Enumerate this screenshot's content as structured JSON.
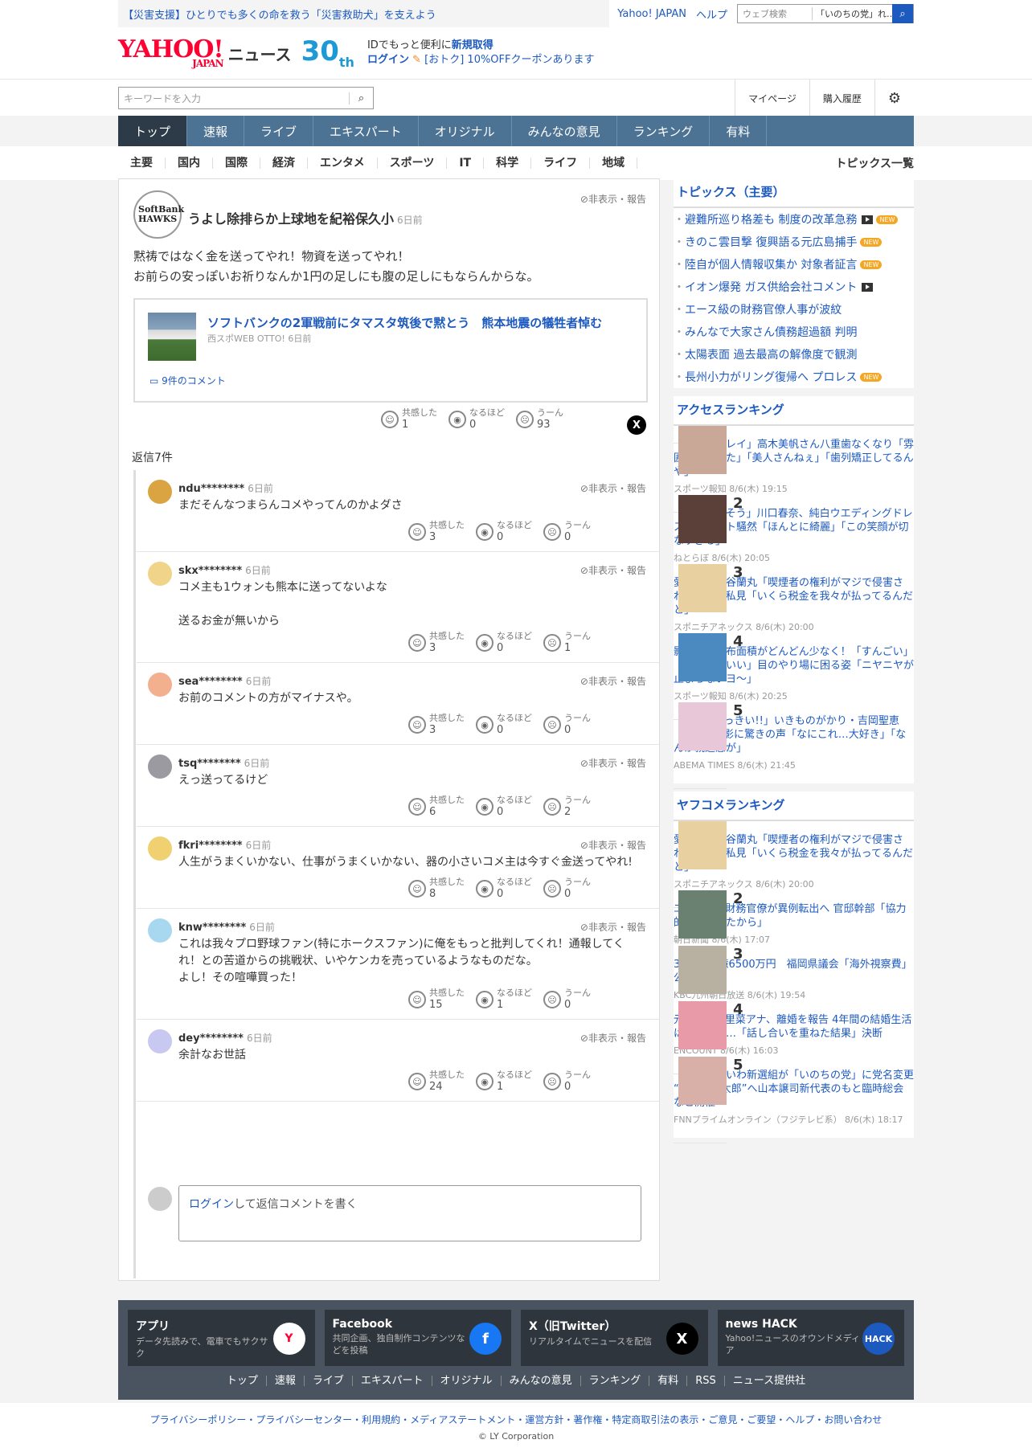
{
  "top": {
    "promo": "【災害支援】ひとりでも多くの命を救う「災害救助犬」を支えよう",
    "links": [
      "Yahoo! JAPAN",
      "ヘルプ"
    ],
    "websearch_placeholder": "ウェブ検索",
    "websearch_selected": "「いのちの党」れ…"
  },
  "logo": {
    "main": "YAHOO!",
    "sub": "JAPAN",
    "news": "ニュース",
    "anniv": "30",
    "anniv_suffix": "th"
  },
  "idpromo": {
    "line1_pre": "IDでもっと便利に",
    "line1_link": "新規取得",
    "login": "ログイン",
    "coupon": "[おトク] 10%OFFクーポンあります"
  },
  "search": {
    "placeholder": "キーワードを入力"
  },
  "header_links": [
    "マイページ",
    "購入履歴"
  ],
  "nav": [
    "トップ",
    "速報",
    "ライブ",
    "エキスパート",
    "オリジナル",
    "みんなの意見",
    "ランキング",
    "有料"
  ],
  "subnav": [
    "主要",
    "国内",
    "国際",
    "経済",
    "エンタメ",
    "スポーツ",
    "IT",
    "科学",
    "ライフ",
    "地域"
  ],
  "subnav_all": "トピックス一覧",
  "hide_report": "非表示・報告",
  "parent": {
    "avatar_text": "SoftBank HAWKS",
    "name": "うよし除排らか上球地を紀裕保久小",
    "time": "6日前",
    "text1": "黙祷ではなく金を送ってやれ！物資を送ってやれ！",
    "text2": "お前らの安っぽいお祈りなんか1円の足しにも腹の足しにもならんからな。",
    "article_title": "ソフトバンクの2軍戦前にタマスタ筑後で黙とう　熊本地震の犠牲者悼む",
    "article_source": "西スポWEB OTTO! 6日前",
    "article_comments": "9件のコメント",
    "reactions": [
      {
        "label": "共感した",
        "count": "1"
      },
      {
        "label": "なるほど",
        "count": "0"
      },
      {
        "label": "うーん",
        "count": "93"
      }
    ],
    "x_label": "X"
  },
  "reply_count": "返信7件",
  "replies": [
    {
      "name": "ndu********",
      "time": "6日前",
      "text": "まだそんなつまらんコメやってんのかよダさ",
      "color": "#d9a441",
      "counts": [
        "3",
        "0",
        "0"
      ]
    },
    {
      "name": "skx********",
      "time": "6日前",
      "text": "コメ主も1ウォンも熊本に送ってないよな\n\n送るお金が無いから",
      "color": "#f0d48a",
      "counts": [
        "3",
        "0",
        "1"
      ]
    },
    {
      "name": "sea********",
      "time": "6日前",
      "text": "お前のコメントの方がマイナスや。",
      "color": "#f2b08e",
      "counts": [
        "3",
        "0",
        "0"
      ]
    },
    {
      "name": "tsq********",
      "time": "6日前",
      "text": "えっ送ってるけど",
      "color": "#9a9aa0",
      "counts": [
        "6",
        "0",
        "2"
      ]
    },
    {
      "name": "fkri********",
      "time": "6日前",
      "text": "人生がうまくいかない、仕事がうまくいかない、器の小さいコメ主は今すぐ金送ってやれ!",
      "color": "#f0d070",
      "counts": [
        "8",
        "0",
        "0"
      ]
    },
    {
      "name": "knw********",
      "time": "6日前",
      "text": "これは我々プロ野球ファン(特にホークスファン)に俺をもっと批判してくれ！通報してくれ！との苦道からの挑戦状、いやケンカを売っているようなものだな。\nよし！その喧嘩買った！",
      "color": "#a8d8f0",
      "counts": [
        "15",
        "1",
        "0"
      ]
    },
    {
      "name": "dey********",
      "time": "6日前",
      "text": "余計なお世話",
      "color": "#c8c8f0",
      "counts": [
        "24",
        "1",
        "0"
      ]
    }
  ],
  "reaction_labels": [
    "共感した",
    "なるほど",
    "うーん"
  ],
  "composer": {
    "login": "ログイン",
    "rest": "して返信コメントを書く"
  },
  "topics": {
    "title": "トピックス（主要）",
    "items": [
      {
        "t": "避難所巡り格差も 制度の改革急務",
        "video": true,
        "new": true
      },
      {
        "t": "きのこ雲目撃 復興語る元広島捕手",
        "video": false,
        "new": true
      },
      {
        "t": "陸自が個人情報収集か 対象者証言",
        "video": false,
        "new": true
      },
      {
        "t": "イオン爆発 ガス供給会社コメント",
        "video": true,
        "new": false
      },
      {
        "t": "エース級の財務官僚人事が波紋",
        "video": false,
        "new": false
      },
      {
        "t": "みんなで大家さん債務超過額 判明",
        "video": false,
        "new": false
      },
      {
        "t": "太陽表面 過去最高の解像度で観測",
        "video": false,
        "new": false
      },
      {
        "t": "長州小力がリング復帰へ プロレス",
        "video": false,
        "new": true
      }
    ],
    "new_label": "NEW"
  },
  "access_ranking": {
    "title": "アクセスランキング",
    "items": [
      {
        "n": "1",
        "t": "「歯並びキレイ」高木美帆さん八重歯なくなり「雰囲気変わった」「美人さんねぇ」「歯列矯正してるんや」",
        "s": "スポーツ報知 8/6(木) 19:15",
        "c": "#c9a898"
      },
      {
        "n": "2",
        "t": "「もう泣きそう」川口春奈、純白ウエディングドレス姿にネット騒然「ほんとに綺麗」「この笑顔が切なすぎる」",
        "s": "ねとらぼ 8/6(木) 20:05",
        "c": "#5a4038"
      },
      {
        "n": "3",
        "t": "愛煙家・岸谷蘭丸「喫煙者の権利がマジで侵害されてる」と私見「いくら税金を我々が払ってるんだと」",
        "s": "スポニチアネックス 8/6(木) 20:00",
        "c": "#e8d0a0"
      },
      {
        "n": "4",
        "t": "影山優佳　布面積がどんどん少なく！「すんごい」「スタイルいい」目のやり場に困る姿「ニヤニヤが止まらないヨ～」",
        "s": "スポーツ報知 8/6(木) 20:25",
        "c": "#4a8ac0"
      },
      {
        "n": "5",
        "t": "「わぁ!!おっきい!!」いきものがかり・吉岡聖恵（42）、近影に驚きの声「なにこれ…大好き」「なんか親近感が」",
        "s": "ABEMA TIMES 8/6(木) 21:45",
        "c": "#e8c8d8"
      }
    ]
  },
  "yafukome_ranking": {
    "title": "ヤフコメランキング",
    "items": [
      {
        "n": "1",
        "t": "愛煙家・岸谷蘭丸「喫煙者の権利がマジで侵害されてる」と私見「いくら税金を我々が払ってるんだと」",
        "s": "スポニチアネックス 8/6(木) 20:00",
        "c": "#e8d0a0"
      },
      {
        "n": "2",
        "t": "エース級の財務官僚が異例転出へ 官邸幹部「協力的でなかったから」",
        "s": "朝日新聞 8/6(木) 17:07",
        "c": "#6a8070"
      },
      {
        "n": "3",
        "t": "3年間で2億6500万円　福岡県議会「海外視察費」公表",
        "s": "KBC九州朝日放送 8/6(木) 19:54",
        "c": "#b8b0a0"
      },
      {
        "n": "4",
        "t": "元TBS山本里菜アナ、離婚を報告 4年間の結婚生活は「宝物」…「話し合いを重ねた結果」決断",
        "s": "ENCOUNT 8/6(木) 16:03",
        "c": "#e89aa8"
      },
      {
        "n": "5",
        "t": "【速報】れいわ新選組が「いのちの党」に党名変更 “脱・山本太郎”へ山本譲司新代表のもと臨時総会など開催",
        "s": "FNNプライムオンライン（フジテレビ系） 8/6(木) 18:17",
        "c": "#d8b0a8"
      }
    ]
  },
  "footer": {
    "apps": [
      {
        "name": "アプリ",
        "desc": "データ先読みで、電車でもサクサク",
        "icon": "Y",
        "color": "#ffffff"
      },
      {
        "name": "Facebook",
        "desc": "共同企画、独自制作コンテンツなどを投稿",
        "icon": "f",
        "color": "#1877f2"
      },
      {
        "name": "X（旧Twitter）",
        "desc": "リアルタイムでニュースを配信",
        "icon": "X",
        "color": "#000000"
      },
      {
        "name": "news HACK",
        "desc": "Yahoo!ニュースのオウンドメディア",
        "icon": "HACK",
        "color": "#1d5ac0"
      }
    ],
    "links": [
      "トップ",
      "速報",
      "ライブ",
      "エキスパート",
      "オリジナル",
      "みんなの意見",
      "ランキング",
      "有料",
      "RSS",
      "ニュース提供社"
    ],
    "legal": "プライバシーポリシー・プライバシーセンター・利用規約・メディアステートメント・運営方針・著作権・特定商取引法の表示・ご意見・ご要望・ヘルプ・お問い合わせ",
    "copyright": "© LY Corporation"
  }
}
